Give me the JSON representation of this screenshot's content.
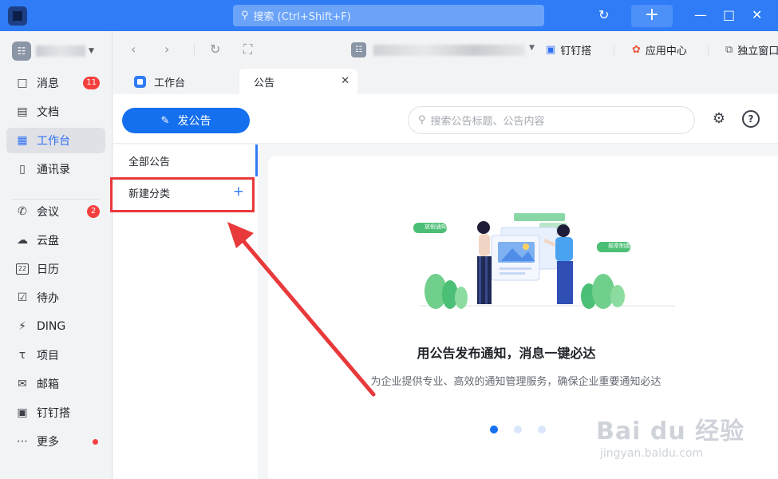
{
  "titlebar": {
    "search_placeholder": "搜索 (Ctrl+Shift+F)",
    "plus_label": "+"
  },
  "leftnav": {
    "items": [
      {
        "label": "消息",
        "badge": "11"
      },
      {
        "label": "文档"
      },
      {
        "label": "工作台",
        "active": true
      },
      {
        "label": "通讯录"
      },
      {
        "label": "会议",
        "badge": "2"
      },
      {
        "label": "云盘"
      },
      {
        "label": "日历"
      },
      {
        "label": "待办"
      },
      {
        "label": "DING"
      },
      {
        "label": "项目"
      },
      {
        "label": "邮箱"
      },
      {
        "label": "钉钉搭"
      },
      {
        "label": "更多",
        "dot": true
      }
    ],
    "calendar_day": "22"
  },
  "toolbar": {
    "links": [
      "钉钉搭",
      "应用中心",
      "独立窗口"
    ]
  },
  "tabs": {
    "workbench": "工作台",
    "announcement": "公告"
  },
  "header": {
    "post_button": "发公告",
    "search_placeholder": "搜索公告标题、公告内容"
  },
  "categories": {
    "all": "全部公告",
    "new": "新建分类",
    "new_plus": "+"
  },
  "illustration": {
    "tag_left": "放假通知",
    "tag_right": "规章制度"
  },
  "empty": {
    "title": "用公告发布通知，消息一键必达",
    "description": "为企业提供专业、高效的通知管理服务，确保企业重要通知必达",
    "pages": 3,
    "current_page": 1
  },
  "watermark": {
    "main": "Bai du 经验",
    "sub": "jingyan.baidu.com"
  },
  "colors": {
    "titlebar": "#2f7cf6",
    "primary": "#1570ef",
    "badge": "#f53f3f",
    "annotation": "#e8393b"
  }
}
